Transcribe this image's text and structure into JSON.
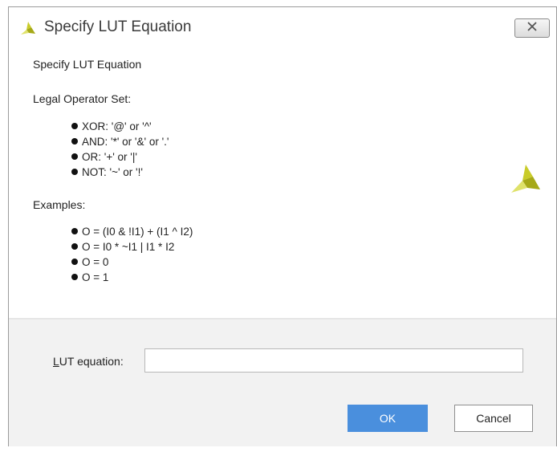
{
  "window": {
    "title": "Specify LUT Equation"
  },
  "content": {
    "heading": "Specify LUT Equation",
    "operators_label": "Legal Operator Set:",
    "operators": [
      "XOR: '@' or '^'",
      "AND: '*' or '&' or '.'",
      "OR: '+' or '|'",
      "NOT: '~' or '!'"
    ],
    "examples_label": "Examples:",
    "examples": [
      "O = (I0 & !I1) + (I1 ^ I2)",
      "O = I0 * ~I1 | I1 * I2",
      "O = 0",
      "O = 1"
    ]
  },
  "form": {
    "lut_label_mnemonic": "L",
    "lut_label_rest": "UT equation:",
    "lut_value": ""
  },
  "buttons": {
    "ok": "OK",
    "cancel": "Cancel"
  },
  "colors": {
    "accent": "#4a8fdd",
    "logo": "#c9cc2a"
  },
  "icons": {
    "title": "app-logo-icon",
    "close": "close-icon",
    "brand": "brand-logo-icon"
  }
}
